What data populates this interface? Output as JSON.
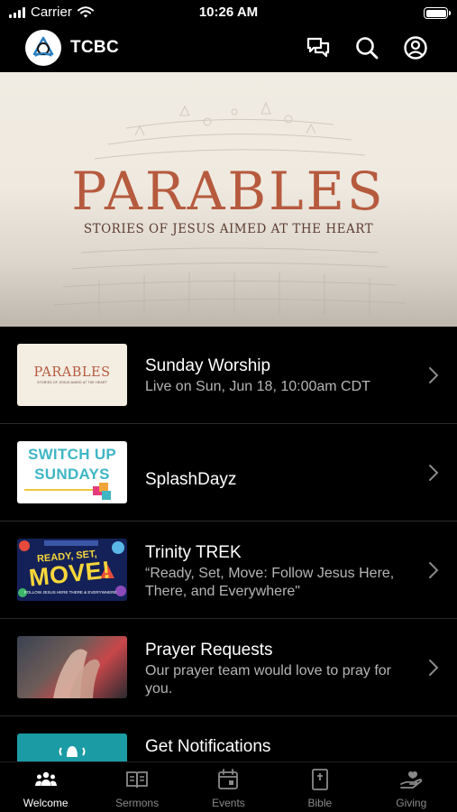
{
  "status_bar": {
    "carrier": "Carrier",
    "time": "10:26 AM"
  },
  "header": {
    "title": "TCBC"
  },
  "hero": {
    "title": "PARABLES",
    "subtitle": "STORIES OF JESUS AIMED AT THE HEART"
  },
  "thumbnails": {
    "parables_title": "PARABLES",
    "parables_sub": "STORIES OF JESUS AIMED AT THE HEART",
    "switch_line1": "SWITCH UP",
    "switch_line2": "SUNDAYS",
    "trek_ready": "READY, SET,",
    "trek_move": "MOVE!",
    "trek_foot": "FOLLOW JESUS HERE THERE & EVERYWHERE"
  },
  "items": [
    {
      "title": "Sunday Worship",
      "subtitle": "Live on Sun, Jun 18, 10:00am CDT"
    },
    {
      "title": "SplashDayz",
      "subtitle": ""
    },
    {
      "title": "Trinity TREK",
      "subtitle": "“Ready, Set, Move: Follow Jesus Here, There, and Everywhere\""
    },
    {
      "title": "Prayer Requests",
      "subtitle": "Our prayer team would love to pray for you."
    },
    {
      "title": "Get Notifications",
      "subtitle": ""
    }
  ],
  "tabs": [
    {
      "label": "Welcome",
      "icon": "people-icon",
      "active": true
    },
    {
      "label": "Sermons",
      "icon": "open-book-icon",
      "active": false
    },
    {
      "label": "Events",
      "icon": "calendar-icon",
      "active": false
    },
    {
      "label": "Bible",
      "icon": "bible-icon",
      "active": false
    },
    {
      "label": "Giving",
      "icon": "giving-hand-icon",
      "active": false
    }
  ],
  "colors": {
    "accent_terracotta": "#b65a3e",
    "background": "#000000",
    "secondary_text": "#b5b5b5",
    "inactive_tab": "#8a8a8a"
  }
}
